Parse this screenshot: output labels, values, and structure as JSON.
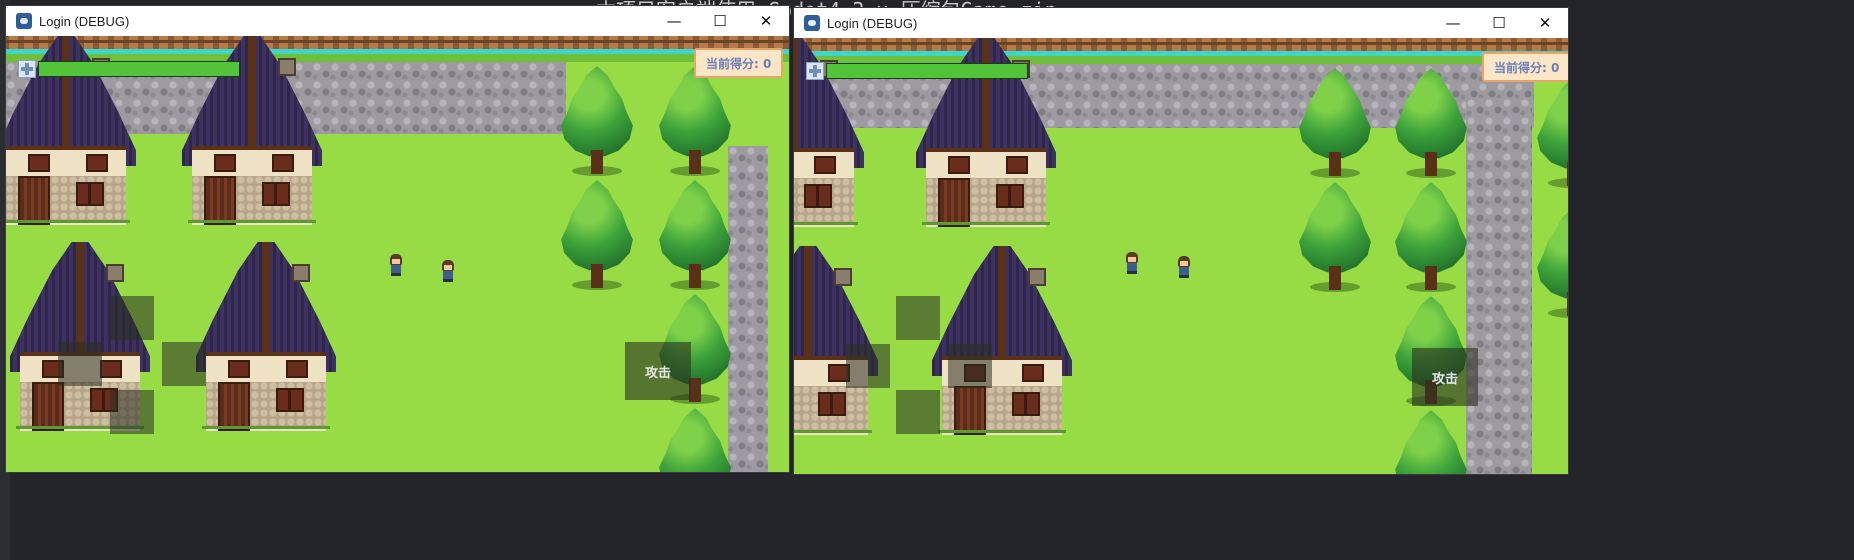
{
  "background": {
    "code_text": "本项目客户端使用 Godot4.2.x 压缩包Game.zip"
  },
  "windows": [
    {
      "id": "left",
      "title": "Login (DEBUG)",
      "controls": {
        "minimize": "—",
        "maximize": "☐",
        "close": "✕"
      },
      "hud": {
        "score_label": "当前得分: 0",
        "health": 1.0
      },
      "attack_label": "攻击"
    },
    {
      "id": "right",
      "title": "Login (DEBUG)",
      "controls": {
        "minimize": "—",
        "maximize": "☐",
        "close": "✕"
      },
      "hud": {
        "score_label": "当前得分: 0",
        "health": 1.0
      },
      "attack_label": "攻击"
    }
  ],
  "colors": {
    "grass": "#98dc45",
    "health_fill": "#52c43a",
    "score_bg": "#fbe6c7",
    "score_text": "#6c7fb8",
    "roof": "#2f2649"
  }
}
